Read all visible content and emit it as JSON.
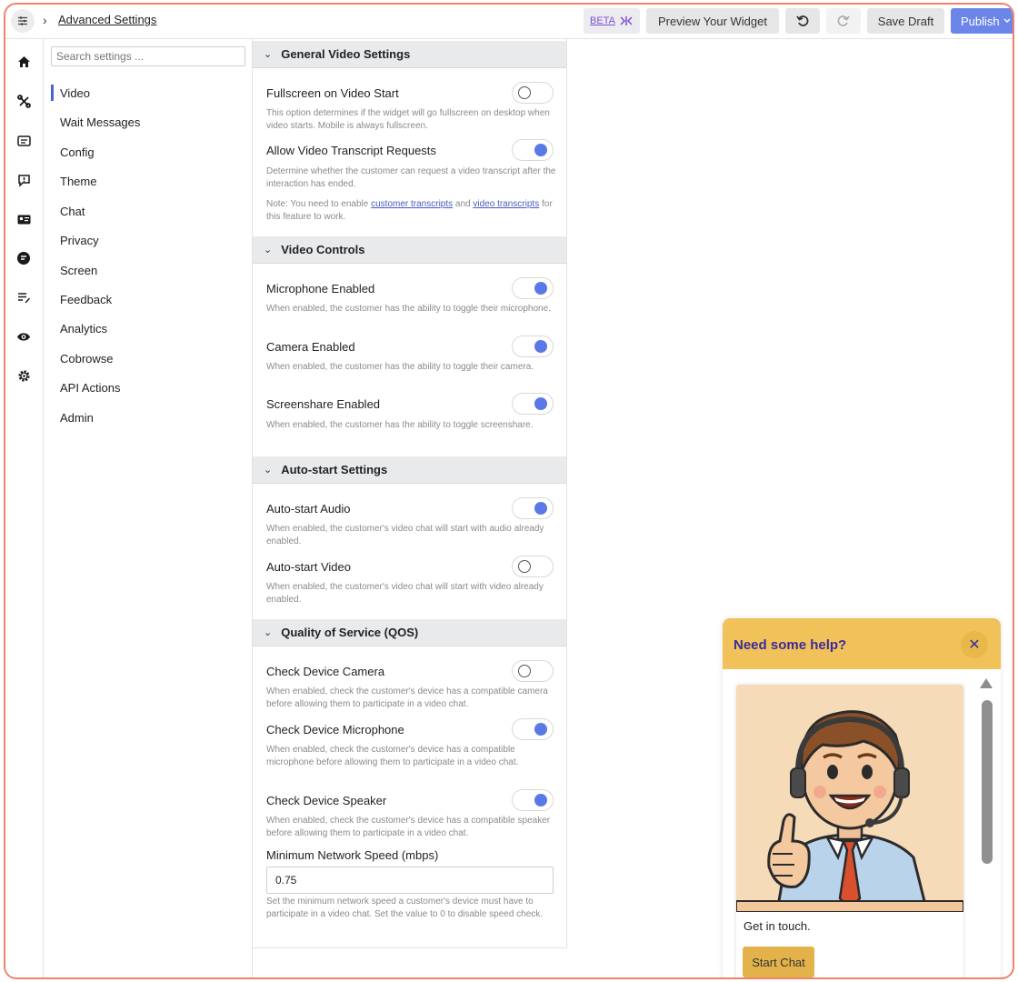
{
  "header": {
    "breadcrumb": "Advanced Settings",
    "beta_label": "BETA",
    "preview_label": "Preview Your Widget",
    "save_label": "Save Draft",
    "publish_label": "Publish"
  },
  "rail_icons": [
    "home-icon",
    "integrations-icon",
    "video-card-icon",
    "feedback-alert-icon",
    "id-card-icon",
    "chat-bubble-icon",
    "edit-note-icon",
    "eye-icon",
    "gear-icon"
  ],
  "nav": {
    "search_placeholder": "Search settings ...",
    "items": [
      "Video",
      "Wait Messages",
      "Config",
      "Theme",
      "Chat",
      "Privacy",
      "Screen",
      "Feedback",
      "Analytics",
      "Cobrowse",
      "API Actions",
      "Admin"
    ]
  },
  "sections": {
    "general": {
      "title": "General Video Settings",
      "fullscreen": {
        "label": "Fullscreen on Video Start",
        "desc": "This option determines if the widget will go fullscreen on desktop when video starts. Mobile is always fullscreen.",
        "enabled": false
      },
      "transcript": {
        "label": "Allow Video Transcript Requests",
        "desc": "Determine whether the customer can request a video transcript after the interaction has ended.",
        "note_prefix": "Note: You need to enable ",
        "link1": "customer transcripts",
        "note_mid": " and ",
        "link2": "video transcripts",
        "note_suffix": " for this feature to work.",
        "enabled": true
      }
    },
    "controls": {
      "title": "Video Controls",
      "microphone": {
        "label": "Microphone Enabled",
        "desc": "When enabled, the customer has the ability to toggle their microphone.",
        "enabled": true
      },
      "camera": {
        "label": "Camera Enabled",
        "desc": "When enabled, the customer has the ability to toggle their camera.",
        "enabled": true
      },
      "screenshare": {
        "label": "Screenshare Enabled",
        "desc": "When enabled, the customer has the ability to toggle screenshare.",
        "enabled": true
      }
    },
    "autostart": {
      "title": "Auto-start Settings",
      "audio": {
        "label": "Auto-start Audio",
        "desc": "When enabled, the customer's video chat will start with audio already enabled.",
        "enabled": true
      },
      "video": {
        "label": "Auto-start Video",
        "desc": "When enabled, the customer's video chat will start with video already enabled.",
        "enabled": false
      }
    },
    "qos": {
      "title": "Quality of Service (QOS)",
      "camera": {
        "label": "Check Device Camera",
        "desc": "When enabled, check the customer's device has a compatible camera before allowing them to participate in a video chat.",
        "enabled": false
      },
      "microphone": {
        "label": "Check Device Microphone",
        "desc": "When enabled, check the customer's device has a compatible microphone before allowing them to participate in a video chat.",
        "enabled": true
      },
      "speaker": {
        "label": "Check Device Speaker",
        "desc": "When enabled, check the customer's device has a compatible speaker before allowing them to participate in a video chat.",
        "enabled": true
      },
      "min_speed": {
        "label": "Minimum Network Speed (mbps)",
        "value": "0.75",
        "desc": "Set the minimum network speed a customer's device must have to participate in a video chat. Set the value to 0 to disable speed check."
      }
    }
  },
  "widget": {
    "title": "Need some help?",
    "text": "Get in touch.",
    "button": "Start Chat"
  },
  "colors": {
    "accent": "#5b79e6",
    "publish": "#6b86e8",
    "widget_header": "#f1c25a",
    "widget_title": "#3b2a9a",
    "border": "#f0826a"
  }
}
